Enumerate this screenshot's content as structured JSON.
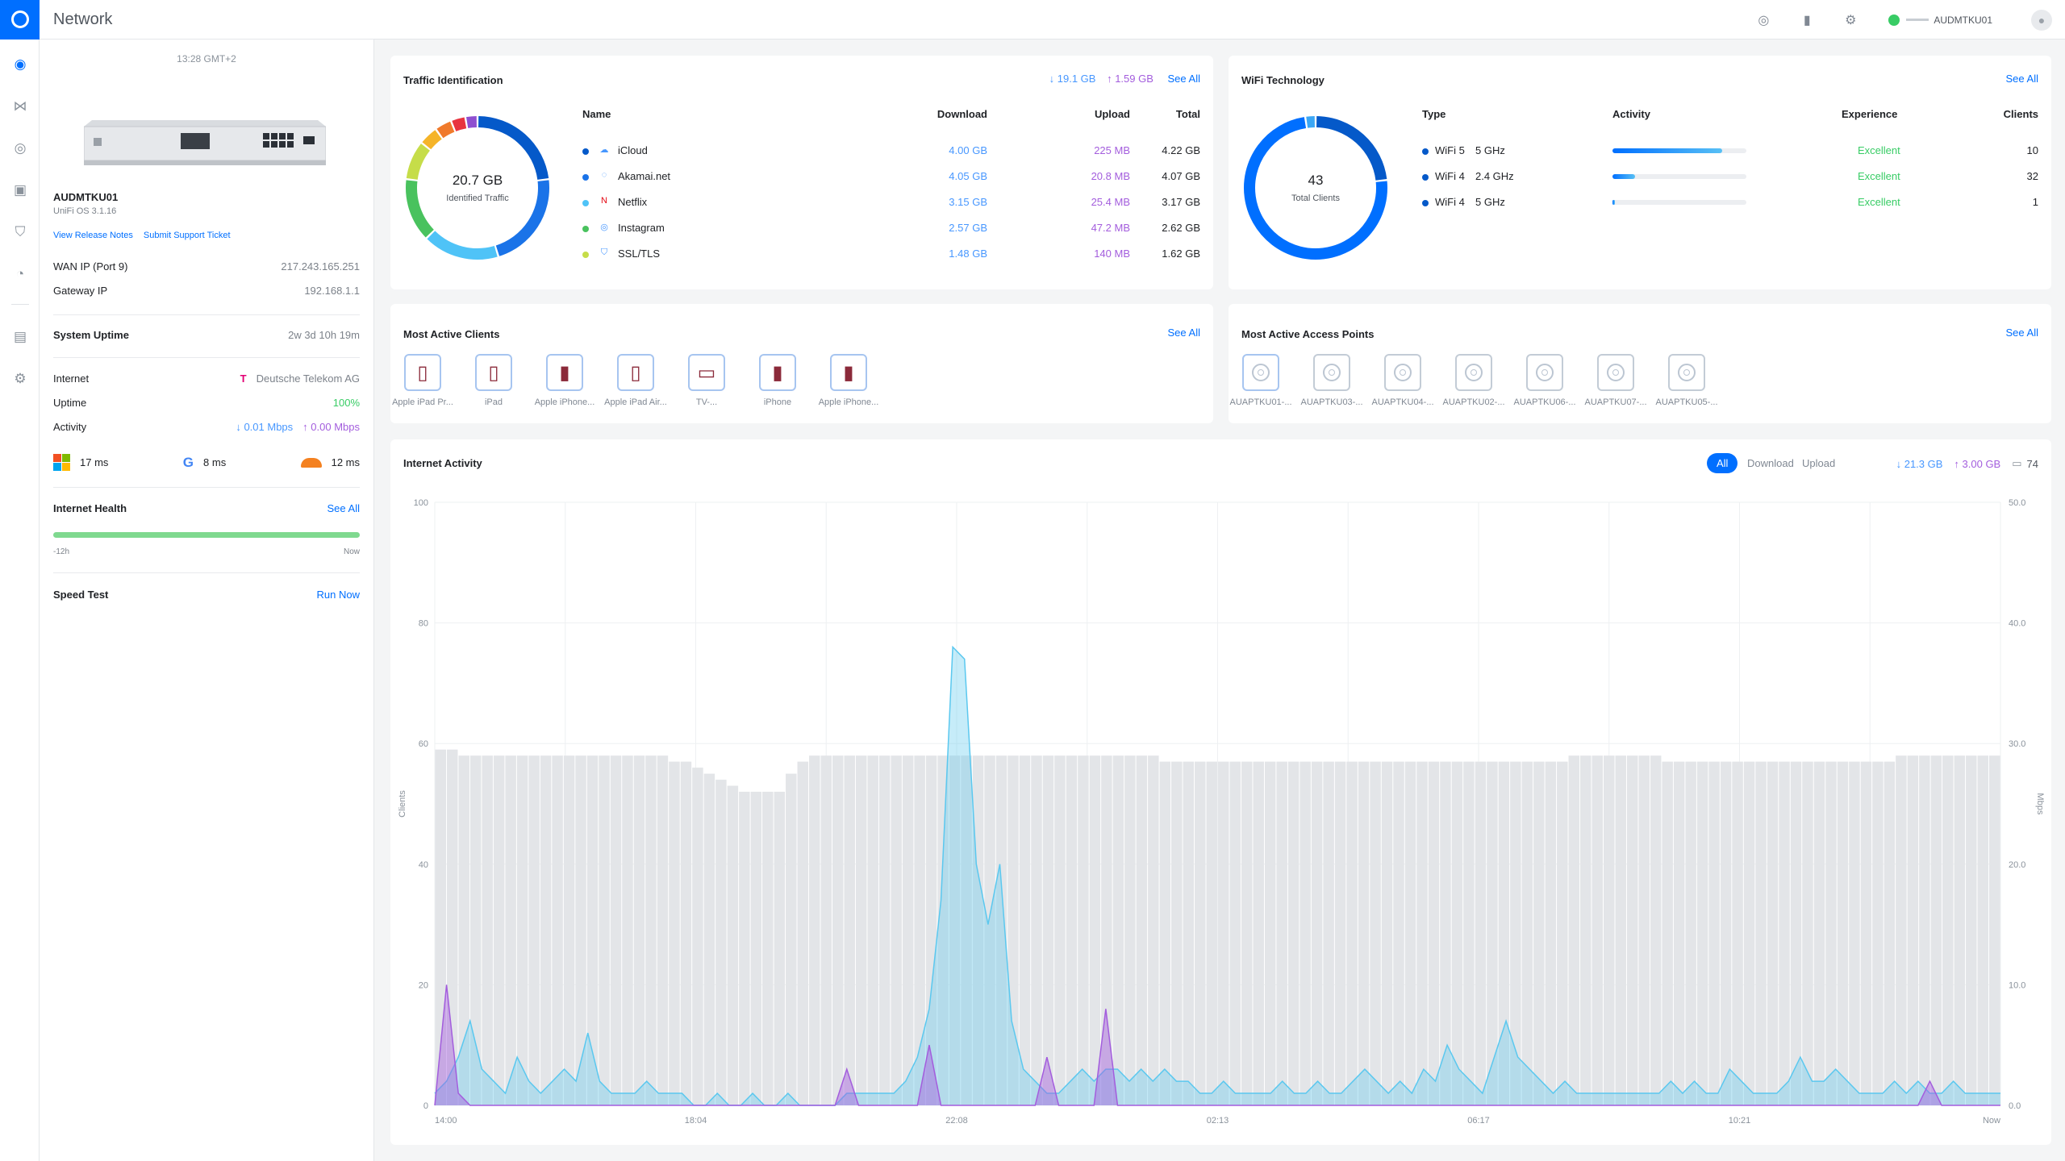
{
  "app": {
    "title": "Network",
    "device_name": "AUDMTKU01"
  },
  "left": {
    "time": "13:28 GMT+2",
    "device_name": "AUDMTKU01",
    "os": "UniFi OS 3.1.16",
    "release_notes": "View Release Notes",
    "support": "Submit Support Ticket",
    "wan_label": "WAN IP (Port 9)",
    "wan_value": "217.243.165.251",
    "gw_label": "Gateway IP",
    "gw_value": "192.168.1.1",
    "uptime_label": "System Uptime",
    "uptime_value": "2w 3d 10h 19m",
    "internet_label": "Internet",
    "isp": "Deutsche Telekom AG",
    "uptime2_label": "Uptime",
    "uptime2_value": "100%",
    "activity_label": "Activity",
    "activity_down": "↓ 0.01 Mbps",
    "activity_up": "↑ 0.00 Mbps",
    "latency": [
      {
        "name": "microsoft-icon",
        "value": "17 ms"
      },
      {
        "name": "google-icon",
        "value": "8 ms"
      },
      {
        "name": "cloudflare-icon",
        "value": "12 ms"
      }
    ],
    "health_label": "Internet Health",
    "health_seeall": "See All",
    "health_start": "-12h",
    "health_end": "Now",
    "speed_label": "Speed Test",
    "speed_action": "Run Now"
  },
  "traffic": {
    "title": "Traffic Identification",
    "down_total": "↓ 19.1 GB",
    "up_total": "↑ 1.59 GB",
    "seeall": "See All",
    "donut_value": "20.7 GB",
    "donut_label": "Identified Traffic",
    "headers": {
      "name": "Name",
      "download": "Download",
      "upload": "Upload",
      "total": "Total"
    },
    "rows": [
      {
        "name": "iCloud",
        "download": "4.00 GB",
        "upload": "225 MB",
        "total": "4.22 GB",
        "color": "#0559c9"
      },
      {
        "name": "Akamai.net",
        "download": "4.05 GB",
        "upload": "20.8 MB",
        "total": "4.07 GB",
        "color": "#1a73e8"
      },
      {
        "name": "Netflix",
        "download": "3.15 GB",
        "upload": "25.4 MB",
        "total": "3.17 GB",
        "color": "#4fc3f7"
      },
      {
        "name": "Instagram",
        "download": "2.57 GB",
        "upload": "47.2 MB",
        "total": "2.62 GB",
        "color": "#49c25e"
      },
      {
        "name": "SSL/TLS",
        "download": "1.48 GB",
        "upload": "140 MB",
        "total": "1.62 GB",
        "color": "#c6dd49"
      }
    ]
  },
  "wifi": {
    "title": "WiFi Technology",
    "seeall": "See All",
    "donut_value": "43",
    "donut_label": "Total Clients",
    "headers": {
      "type": "Type",
      "activity": "Activity",
      "experience": "Experience",
      "clients": "Clients"
    },
    "rows": [
      {
        "standard": "WiFi 5",
        "band": "5 GHz",
        "activity": 0.82,
        "experience": "Excellent",
        "clients": "10"
      },
      {
        "standard": "WiFi 4",
        "band": "2.4 GHz",
        "activity": 0.17,
        "experience": "Excellent",
        "clients": "32"
      },
      {
        "standard": "WiFi 4",
        "band": "5 GHz",
        "activity": 0.02,
        "experience": "Excellent",
        "clients": "1"
      }
    ]
  },
  "clients": {
    "title": "Most Active Clients",
    "seeall": "See All",
    "items": [
      {
        "label": "Apple iPad Pr...",
        "icon": "ipad-icon"
      },
      {
        "label": "iPad",
        "icon": "ipad-icon"
      },
      {
        "label": "Apple iPhone...",
        "icon": "iphone-icon"
      },
      {
        "label": "Apple iPad Air...",
        "icon": "ipad-icon"
      },
      {
        "label": "TV-...",
        "icon": "tv-icon"
      },
      {
        "label": "iPhone",
        "icon": "iphone-icon"
      },
      {
        "label": "Apple iPhone...",
        "icon": "iphone-icon"
      }
    ]
  },
  "aps": {
    "title": "Most Active Access Points",
    "seeall": "See All",
    "items": [
      {
        "label": "AUAPTKU01-..."
      },
      {
        "label": "AUAPTKU03-..."
      },
      {
        "label": "AUAPTKU04-..."
      },
      {
        "label": "AUAPTKU02-..."
      },
      {
        "label": "AUAPTKU06-..."
      },
      {
        "label": "AUAPTKU07-..."
      },
      {
        "label": "AUAPTKU05-..."
      }
    ]
  },
  "activity": {
    "title": "Internet Activity",
    "toggles": {
      "all": "All",
      "download": "Download",
      "upload": "Upload"
    },
    "down_total": "↓ 21.3 GB",
    "up_total": "↑ 3.00 GB",
    "clients_total": "74",
    "left_axis_label": "Clients",
    "right_axis_label": "Mbps"
  },
  "chart_data": {
    "type": "area",
    "x_labels": [
      "14:00",
      "18:04",
      "22:08",
      "02:13",
      "06:17",
      "10:21",
      "Now"
    ],
    "left_axis": {
      "label": "Clients",
      "ticks": [
        0,
        20,
        40,
        60,
        80,
        100
      ],
      "range": [
        0,
        100
      ]
    },
    "right_axis": {
      "label": "Mbps",
      "ticks": [
        "0.0",
        "10.0",
        "20.0",
        "30.0",
        "40.0",
        "50.0"
      ],
      "range": [
        0,
        50
      ]
    },
    "grid": true,
    "series": [
      {
        "name": "Clients",
        "type": "bar",
        "color": "#e3e5e8",
        "values": [
          59,
          59,
          58,
          58,
          58,
          58,
          58,
          58,
          58,
          58,
          58,
          58,
          58,
          58,
          58,
          58,
          58,
          58,
          58,
          58,
          57,
          57,
          56,
          55,
          54,
          53,
          52,
          52,
          52,
          52,
          55,
          57,
          58,
          58,
          58,
          58,
          58,
          58,
          58,
          58,
          58,
          58,
          58,
          58,
          58,
          58,
          58,
          58,
          58,
          58,
          58,
          58,
          58,
          58,
          58,
          58,
          58,
          58,
          58,
          58,
          58,
          58,
          57,
          57,
          57,
          57,
          57,
          57,
          57,
          57,
          57,
          57,
          57,
          57,
          57,
          57,
          57,
          57,
          57,
          57,
          57,
          57,
          57,
          57,
          57,
          57,
          57,
          57,
          57,
          57,
          57,
          57,
          57,
          57,
          57,
          57,
          57,
          58,
          58,
          58,
          58,
          58,
          58,
          58,
          58,
          57,
          57,
          57,
          57,
          57,
          57,
          57,
          57,
          57,
          57,
          57,
          57,
          57,
          57,
          57,
          57,
          57,
          57,
          57,
          57,
          58,
          58,
          58,
          58,
          58,
          58,
          58,
          58,
          58
        ]
      },
      {
        "name": "Download",
        "type": "area",
        "color": "#5bc8ef",
        "values": [
          1,
          2,
          4,
          7,
          3,
          2,
          1,
          4,
          2,
          1,
          2,
          3,
          2,
          6,
          2,
          1,
          1,
          1,
          2,
          1,
          1,
          1,
          0,
          0,
          1,
          0,
          0,
          1,
          0,
          0,
          1,
          0,
          0,
          0,
          0,
          1,
          1,
          1,
          1,
          1,
          2,
          4,
          8,
          17,
          38,
          37,
          20,
          15,
          20,
          7,
          3,
          2,
          1,
          1,
          2,
          3,
          2,
          3,
          3,
          2,
          3,
          2,
          3,
          2,
          2,
          1,
          1,
          2,
          1,
          1,
          1,
          1,
          2,
          1,
          1,
          2,
          1,
          1,
          2,
          3,
          2,
          1,
          2,
          1,
          3,
          2,
          5,
          3,
          2,
          1,
          4,
          7,
          4,
          3,
          2,
          1,
          2,
          1,
          1,
          1,
          1,
          1,
          1,
          1,
          1,
          2,
          1,
          2,
          1,
          1,
          3,
          2,
          1,
          1,
          1,
          2,
          4,
          2,
          2,
          3,
          2,
          1,
          1,
          1,
          2,
          1,
          2,
          1,
          1,
          2,
          1,
          1,
          1,
          1
        ]
      },
      {
        "name": "Upload",
        "type": "area",
        "color": "#a35ddd",
        "values": [
          0,
          10,
          1,
          0,
          0,
          0,
          0,
          0,
          0,
          0,
          0,
          0,
          0,
          0,
          0,
          0,
          0,
          0,
          0,
          0,
          0,
          0,
          0,
          0,
          0,
          0,
          0,
          0,
          0,
          0,
          0,
          0,
          0,
          0,
          0,
          3,
          0,
          0,
          0,
          0,
          0,
          0,
          5,
          0,
          0,
          0,
          0,
          0,
          0,
          0,
          0,
          0,
          4,
          0,
          0,
          0,
          0,
          8,
          0,
          0,
          0,
          0,
          0,
          0,
          0,
          0,
          0,
          0,
          0,
          0,
          0,
          0,
          0,
          0,
          0,
          0,
          0,
          0,
          0,
          0,
          0,
          0,
          0,
          0,
          0,
          0,
          0,
          0,
          0,
          0,
          0,
          0,
          0,
          0,
          0,
          0,
          0,
          0,
          0,
          0,
          0,
          0,
          0,
          0,
          0,
          0,
          0,
          0,
          0,
          0,
          0,
          0,
          0,
          0,
          0,
          0,
          0,
          0,
          0,
          0,
          0,
          0,
          0,
          0,
          0,
          0,
          0,
          2,
          0,
          0,
          0,
          0,
          0,
          0
        ]
      }
    ]
  }
}
